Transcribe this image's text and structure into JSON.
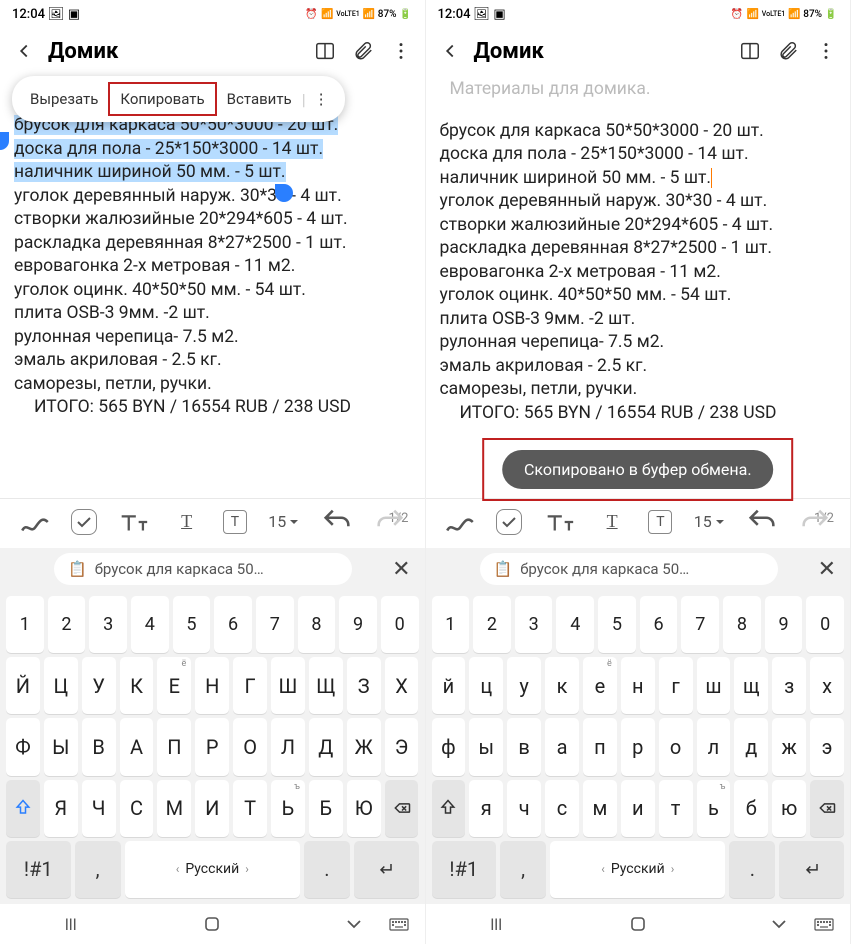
{
  "status": {
    "time": "12:04",
    "battery": "87%"
  },
  "header": {
    "title": "Домик"
  },
  "context_menu": {
    "cut": "Вырезать",
    "copy": "Копировать",
    "paste": "Вставить",
    "more": "⋮"
  },
  "note": {
    "heading_faded": "Материалы для домика.",
    "lines": [
      "брусок для каркаса 50*50*3000 - 20 шт.",
      "доска для пола - 25*150*3000 - 14 шт.",
      "наличник шириной 50 мм. - 5 шт.",
      "уголок деревянный наруж. 30*30 - 4 шт.",
      "створки жалюзийные 20*294*605 - 4 шт.",
      "раскладка деревянная 8*27*2500 - 1 шт.",
      "евровагонка 2-х метровая - 11 м2.",
      "уголок оцинк. 40*50*50 мм. - 54 шт.",
      "плита OSB-3 9мм. -2 шт.",
      "рулонная черепица- 7.5 м2.",
      "эмаль акриловая - 2.5 кг.",
      "саморезы,  петли, ручки."
    ],
    "total": "ИТОГО: 565 BYN / 16554 RUB / 238 USD",
    "pager": "1/2"
  },
  "toast": {
    "text": "Скопировано в буфер обмена."
  },
  "toolbar": {
    "fontsize": "15"
  },
  "clipboard": {
    "preview": "брусок для каркаса 50…"
  },
  "keyboard": {
    "row_num": [
      "1",
      "2",
      "3",
      "4",
      "5",
      "6",
      "7",
      "8",
      "9",
      "0"
    ],
    "row1": [
      "й",
      "ц",
      "у",
      "к",
      "е",
      "н",
      "г",
      "ш",
      "щ",
      "з",
      "х"
    ],
    "row1_sup": [
      "",
      "",
      "",
      "",
      "ё",
      "",
      "",
      "",
      "",
      "",
      ""
    ],
    "row2": [
      "ф",
      "ы",
      "в",
      "а",
      "п",
      "р",
      "о",
      "л",
      "д",
      "ж",
      "э"
    ],
    "row3": [
      "я",
      "ч",
      "с",
      "м",
      "и",
      "т",
      "ь",
      "б",
      "ю"
    ],
    "row3_sup": [
      "",
      "",
      "",
      "",
      "",
      "",
      "ъ",
      "",
      ""
    ],
    "sym": "!#1",
    "comma": ",",
    "lang": "Русский",
    "period": "."
  },
  "nav": {
    "recents": "|||"
  }
}
